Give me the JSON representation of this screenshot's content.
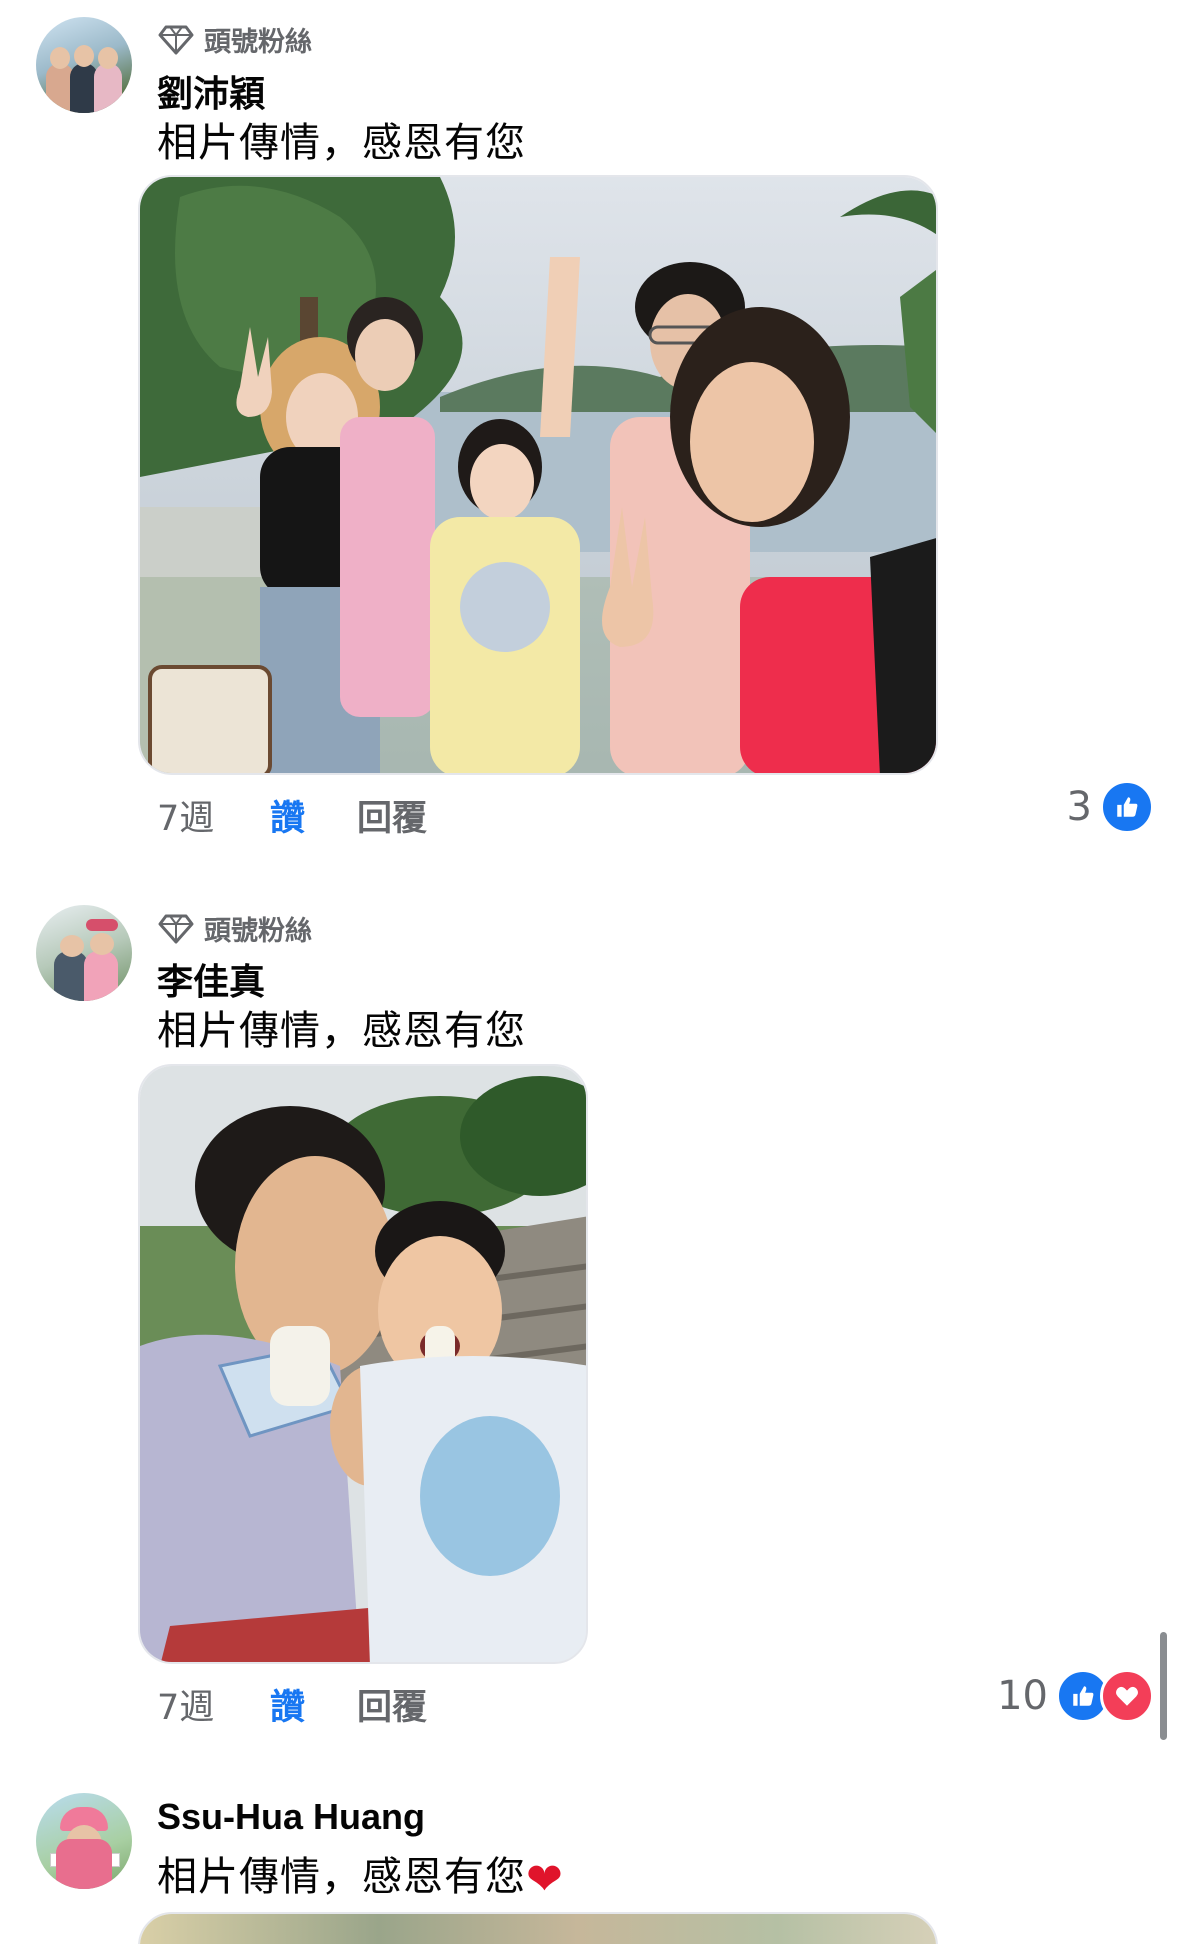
{
  "comments": [
    {
      "badge": "頭號粉絲",
      "author": "劉沛穎",
      "text": "相片傳情，感恩有您",
      "time": "7週",
      "like_label": "讚",
      "reply_label": "回覆",
      "reaction_count": "3",
      "reaction_icons": [
        "like-icon"
      ],
      "photo_description_icon": "group-selfie-photo"
    },
    {
      "badge": "頭號粉絲",
      "author": "李佳真",
      "text": "相片傳情，感恩有您",
      "time": "7週",
      "like_label": "讚",
      "reply_label": "回覆",
      "reaction_count": "10",
      "reaction_icons": [
        "like-icon",
        "love-icon"
      ],
      "photo_description_icon": "popsicle-selfie-photo"
    },
    {
      "author": "Ssu-Hua Huang",
      "text": "相片傳情，感恩有您",
      "emoji": "❤"
    }
  ],
  "colors": {
    "accent": "#1877f2",
    "love": "#f33e58",
    "secondary_text": "#65676b"
  }
}
